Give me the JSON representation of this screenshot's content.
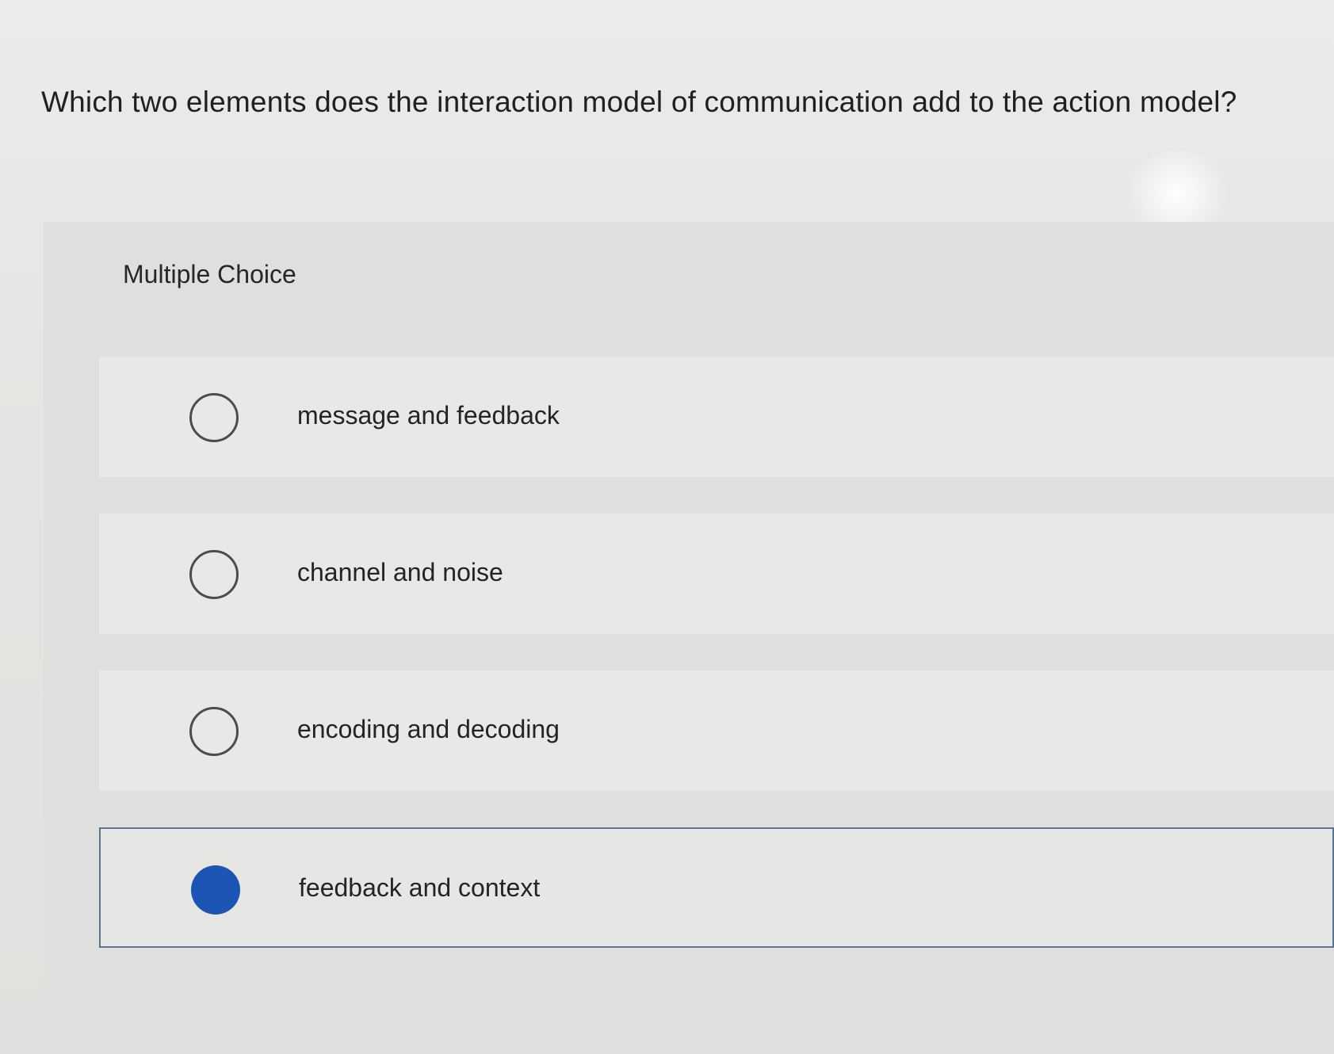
{
  "question": {
    "text": "Which two elements does the interaction model of communication add to the action model?"
  },
  "choice_section": {
    "type_label": "Multiple Choice",
    "options": [
      {
        "label": "message and feedback",
        "selected": false
      },
      {
        "label": "channel and noise",
        "selected": false
      },
      {
        "label": "encoding and decoding",
        "selected": false
      },
      {
        "label": "feedback and context",
        "selected": true
      }
    ]
  },
  "colors": {
    "selected_radio": "#1d55b4",
    "selected_border": "#5e7391",
    "background": "#e7e8e5"
  }
}
